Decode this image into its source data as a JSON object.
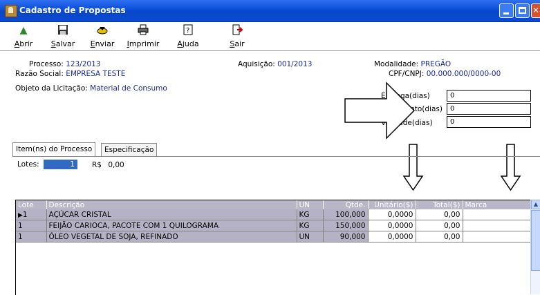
{
  "window": {
    "title": "Cadastro de Propostas"
  },
  "toolbar": [
    {
      "label": "Abrir",
      "icon": "open-folder-icon",
      "glyph": "📂"
    },
    {
      "label": "Salvar",
      "icon": "floppy-disk-icon",
      "glyph": "💾"
    },
    {
      "label": "Enviar",
      "icon": "send-icon",
      "glyph": "📤"
    },
    {
      "label": "Imprimir",
      "icon": "printer-icon",
      "glyph": "🖨"
    },
    {
      "label": "Ajuda",
      "icon": "help-icon",
      "glyph": "❓"
    },
    {
      "label": "Sair",
      "icon": "exit-door-icon",
      "glyph": "🚪"
    }
  ],
  "header": {
    "processo_label": "Processo:",
    "processo_value": "123/2013",
    "razao_label": "Razão Social:",
    "razao_value": "EMPRESA TESTE",
    "objeto_label": "Objeto da Licitação:",
    "objeto_value": "Material de Consumo",
    "aquisicao_label": "Aquisição:",
    "aquisicao_value": "001/2013",
    "modalidade_label": "Modalidade:",
    "modalidade_value": "PREGÃO",
    "cpf_label": "CPF/CNPJ:",
    "cpf_value": "00.000.000/0000-00"
  },
  "fields": {
    "entrega_label": "Entrega(dias)",
    "entrega_value": "0",
    "pagamento_label": "Pagamento(dias)",
    "pagamento_value": "0",
    "validade_label": "Validade(dias)",
    "validade_value": "0"
  },
  "tabs": [
    "Item(ns) do Processo",
    "Especificação"
  ],
  "lotes": {
    "label": "Lotes:",
    "value": "1",
    "currency": "R$",
    "amount": "0,00"
  },
  "grid": {
    "columns": [
      "Lote",
      "Descrição",
      "UN",
      "Qtde.",
      "Unitário($)",
      "Total($)",
      "Marca"
    ],
    "rows": [
      {
        "lote": "1",
        "descricao": "AÇÚCAR CRISTAL",
        "un": "KG",
        "qtde": "100,000",
        "unitario": "0,0000",
        "total": "0,00",
        "marca": ""
      },
      {
        "lote": "1",
        "descricao": "FEIJÃO CARIOCA, PACOTE COM 1 QUILOGRAMA",
        "un": "KG",
        "qtde": "150,000",
        "unitario": "0,0000",
        "total": "0,00",
        "marca": ""
      },
      {
        "lote": "1",
        "descricao": "ÓLEO VEGETAL DE SOJA, REFINADO",
        "un": "UN",
        "qtde": "90,000",
        "unitario": "0,0000",
        "total": "0,00",
        "marca": ""
      }
    ]
  },
  "colors": {
    "title_bar": "#0a4fd8",
    "value_text": "#1a2a9e",
    "lotes_highlight": "#316ac5",
    "grid_header": "#b9b7c7"
  }
}
